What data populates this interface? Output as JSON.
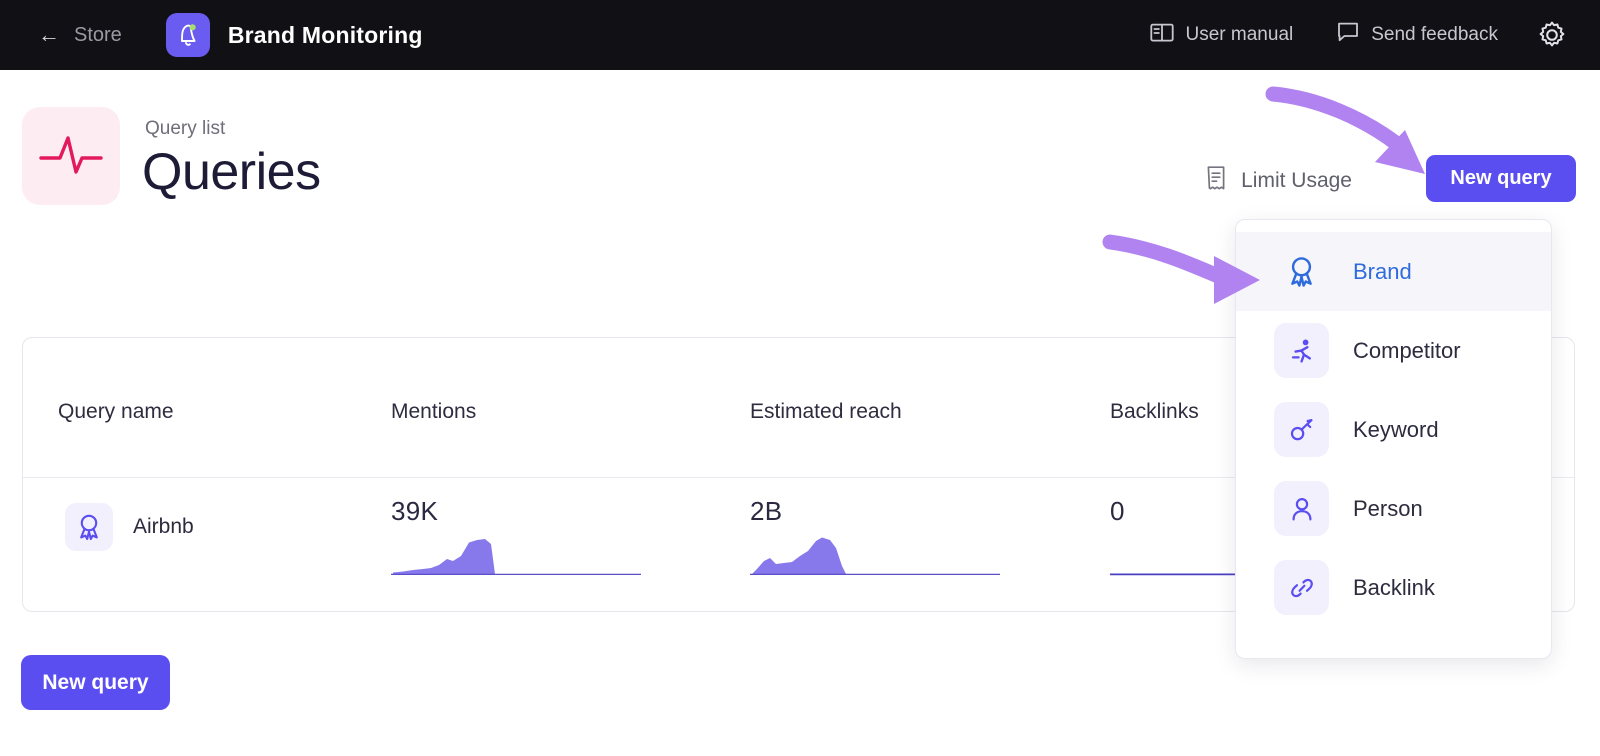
{
  "topbar": {
    "back_label": "Store",
    "back_icon": "arrow-left-icon",
    "app_logo_icon": "bell-notification-icon",
    "app_title": "Brand Monitoring",
    "items": [
      {
        "label": "User manual",
        "icon": "book-open-icon"
      },
      {
        "label": "Send feedback",
        "icon": "speech-bubble-icon"
      }
    ],
    "settings_icon": "gear-icon"
  },
  "page": {
    "icon": "pulse-icon",
    "kicker": "Query list",
    "title": "Queries",
    "limit_usage_label": "Limit Usage",
    "limit_usage_icon": "receipt-icon",
    "new_query_label": "New query"
  },
  "table": {
    "columns": [
      "Query name",
      "Mentions",
      "Estimated reach",
      "Backlinks"
    ],
    "rows": [
      {
        "icon": "award-ribbon-icon",
        "name": "Airbnb",
        "mentions": "39K",
        "estimated_reach": "2B",
        "backlinks": "0"
      }
    ]
  },
  "footer": {
    "new_query_label": "New query"
  },
  "dropdown": {
    "items": [
      {
        "label": "Brand",
        "icon": "award-ribbon-icon",
        "active": true
      },
      {
        "label": "Competitor",
        "icon": "runner-icon",
        "active": false
      },
      {
        "label": "Keyword",
        "icon": "key-icon",
        "active": false
      },
      {
        "label": "Person",
        "icon": "person-icon",
        "active": false
      },
      {
        "label": "Backlink",
        "icon": "link-chain-icon",
        "active": false
      }
    ]
  },
  "annotations": [
    {
      "name": "arrow-to-new-query-button",
      "color": "#b183f0"
    },
    {
      "name": "arrow-to-brand-menu-item",
      "color": "#b183f0"
    }
  ],
  "colors": {
    "accent_purple": "#5b4ef0",
    "topbar_bg": "#111015",
    "annotation_purple": "#b183f0",
    "pulse_pink": "#e3195e",
    "pulse_bg": "#fdecf2",
    "active_link_blue": "#2f6bdd"
  },
  "chart_data": [
    {
      "type": "area",
      "title": "Mentions sparkline",
      "x": [
        0,
        1,
        2,
        3,
        4,
        5,
        6,
        7,
        8,
        9,
        10,
        11,
        12,
        13,
        14,
        15,
        16,
        17,
        18,
        19,
        20,
        21,
        22,
        23,
        24
      ],
      "values": [
        0,
        2,
        3,
        3,
        3,
        4,
        5,
        8,
        7,
        9,
        16,
        18,
        19,
        17,
        0,
        0,
        0,
        0,
        0,
        0,
        0,
        0,
        0,
        0,
        0
      ],
      "ylim": [
        0,
        20
      ]
    },
    {
      "type": "area",
      "title": "Estimated reach sparkline",
      "x": [
        0,
        1,
        2,
        3,
        4,
        5,
        6,
        7,
        8,
        9,
        10,
        11,
        12,
        13,
        14,
        15,
        16,
        17,
        18,
        19,
        20,
        21,
        22,
        23,
        24
      ],
      "values": [
        0,
        3,
        7,
        4,
        5,
        5,
        6,
        9,
        13,
        20,
        22,
        19,
        13,
        1,
        0,
        0,
        0,
        0,
        0,
        0,
        0,
        0,
        0,
        0,
        0
      ],
      "ylim": [
        0,
        24
      ]
    },
    {
      "type": "area",
      "title": "Backlinks sparkline",
      "x": [
        0,
        1,
        2,
        3,
        4,
        5,
        6,
        7,
        8,
        9,
        10,
        11,
        12,
        13,
        14,
        15,
        16,
        17,
        18,
        19,
        20,
        21,
        22,
        23,
        24
      ],
      "values": [
        0,
        0,
        0,
        0,
        0,
        0,
        0,
        0,
        0,
        0,
        0,
        0,
        0,
        0,
        0,
        0,
        0,
        0,
        0,
        0,
        0,
        0,
        0,
        0,
        0
      ],
      "ylim": [
        0,
        1
      ]
    }
  ]
}
